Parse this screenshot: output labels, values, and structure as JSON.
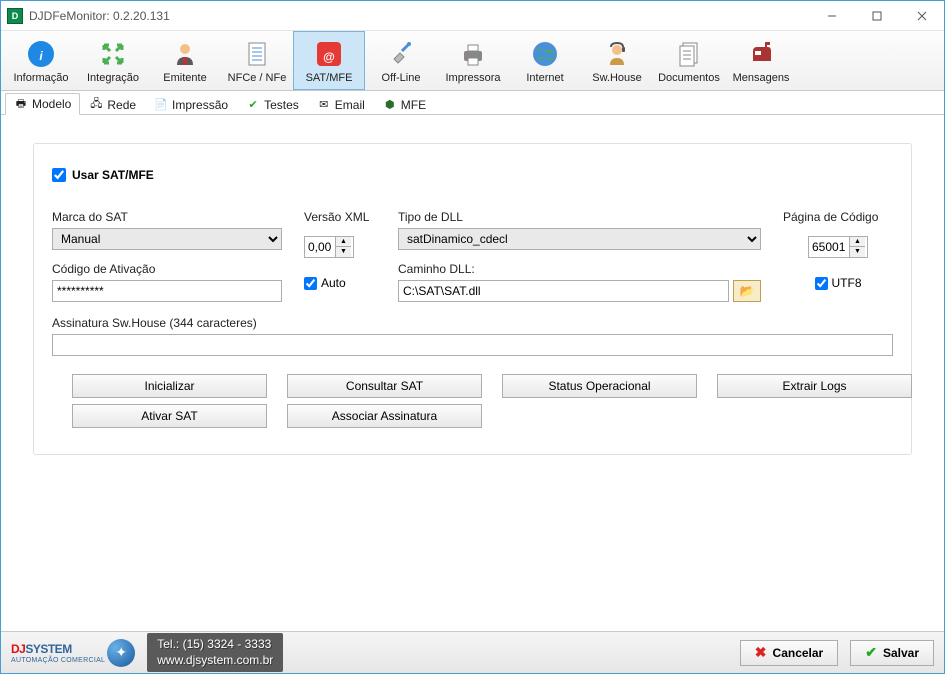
{
  "window": {
    "title": "DJDFeMonitor: 0.2.20.131"
  },
  "toolbar": [
    {
      "id": "informacao",
      "label": "Informação"
    },
    {
      "id": "integracao",
      "label": "Integração"
    },
    {
      "id": "emitente",
      "label": "Emitente"
    },
    {
      "id": "nfce",
      "label": "NFCe / NFe"
    },
    {
      "id": "satmfe",
      "label": "SAT/MFE"
    },
    {
      "id": "offline",
      "label": "Off-Line"
    },
    {
      "id": "impressora",
      "label": "Impressora"
    },
    {
      "id": "internet",
      "label": "Internet"
    },
    {
      "id": "swhouse",
      "label": "Sw.House"
    },
    {
      "id": "documentos",
      "label": "Documentos"
    },
    {
      "id": "mensagens",
      "label": "Mensagens"
    }
  ],
  "subtabs": [
    {
      "id": "modelo",
      "label": "Modelo"
    },
    {
      "id": "rede",
      "label": "Rede"
    },
    {
      "id": "impressao",
      "label": "Impressão"
    },
    {
      "id": "testes",
      "label": "Testes"
    },
    {
      "id": "email",
      "label": "Email"
    },
    {
      "id": "mfe",
      "label": "MFE"
    }
  ],
  "form": {
    "usar_sat_label": "Usar SAT/MFE",
    "usar_sat_checked": true,
    "marca_label": "Marca do SAT",
    "marca_value": "Manual",
    "versao_label": "Versão XML",
    "versao_value": "0,00",
    "auto_label": "Auto",
    "auto_checked": true,
    "tipo_dll_label": "Tipo de DLL",
    "tipo_dll_value": "satDinamico_cdecl",
    "caminho_label": "Caminho DLL:",
    "caminho_value": "C:\\SAT\\SAT.dll",
    "codigo_label": "Código de Ativação",
    "codigo_value": "**********",
    "assinatura_label": "Assinatura Sw.House (344 caracteres)",
    "assinatura_value": "",
    "pagina_label": "Página de Código",
    "pagina_value": "65001",
    "utf8_label": "UTF8",
    "utf8_checked": true
  },
  "buttons": {
    "inicializar": "Inicializar",
    "consultar": "Consultar SAT",
    "status": "Status Operacional",
    "extrair": "Extrair Logs",
    "ativar": "Ativar SAT",
    "associar": "Associar Assinatura"
  },
  "footer": {
    "brand_dj": "DJ",
    "brand_sys": "SYSTEM",
    "brand_sub": "AUTOMAÇÃO COMERCIAL",
    "tel": "Tel.: (15) 3324 - 3333",
    "site": "www.djsystem.com.br",
    "cancelar": "Cancelar",
    "salvar": "Salvar"
  }
}
